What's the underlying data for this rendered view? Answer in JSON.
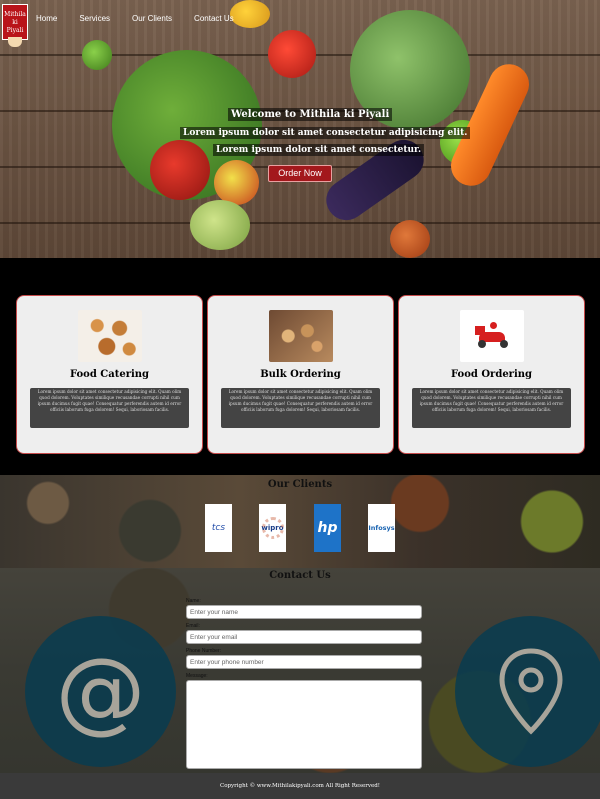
{
  "brand": {
    "logo_text": "Mithila ki Piyali"
  },
  "nav": {
    "items": [
      {
        "label": "Home"
      },
      {
        "label": "Services"
      },
      {
        "label": "Our Clients"
      },
      {
        "label": "Contact Us"
      }
    ]
  },
  "hero": {
    "welcome": "Welcome to Mithila ki Piyali",
    "line1": "Lorem ipsum dolor sit amet consectetur adipisicing elit.",
    "line2": "Lorem ipsum dolor sit amet consectetur.",
    "cta_label": "Order Now"
  },
  "services": {
    "cards": [
      {
        "title": "Food Catering",
        "icon": "catering-image",
        "description": "Lorem ipsum dolor sit amet consectetur adipisicing elit. Quam olim quod dolorem. Voluptates similique recusandae corrupti nihil cum ipsum ducimus fugit quae! Consequatur perferendis autem id error officiis laborum fuga dolorem! Sequi, laboriosam facilis."
      },
      {
        "title": "Bulk Ordering",
        "icon": "bulk-image",
        "description": "Lorem ipsum dolor sit amet consectetur adipisicing elit. Quam olim quod dolorem. Voluptates similique recusandae corrupti nihil cum ipsum ducimus fugit quae! Consequatur perferendis autem id error officiis laborum fuga dolorem! Sequi, laboriosam facilis."
      },
      {
        "title": "Food Ordering",
        "icon": "delivery-scooter-image",
        "description": "Lorem ipsum dolor sit amet consectetur adipisicing elit. Quam olim quod dolorem. Voluptates similique recusandae corrupti nihil cum ipsum ducimus fugit quae! Consequatur perferendis autem id error officiis laborum fuga dolorem! Sequi, laboriosam facilis."
      }
    ]
  },
  "clients": {
    "title": "Our Clients",
    "logos": [
      {
        "name": "tcs"
      },
      {
        "name": "wipro"
      },
      {
        "name": "hp"
      },
      {
        "name": "Infosys"
      }
    ]
  },
  "contact": {
    "title": "Contact Us",
    "fields": {
      "name_label": "Name:",
      "name_placeholder": "Enter your name",
      "email_label": "Email:",
      "email_placeholder": "Enter your email",
      "phone_label": "Phone Number:",
      "phone_placeholder": "Enter your phone number",
      "message_label": "Message:"
    },
    "icons": [
      "at-icon",
      "map-pin-icon"
    ]
  },
  "footer": {
    "copyright": "Copyright © www.Mithilakipyali.com All Right Reserved!"
  },
  "colors": {
    "accent_red": "#a3181c",
    "card_bg": "#eeeeee",
    "card_border": "#c64b4b",
    "footer_bg": "#3a3a3a"
  }
}
